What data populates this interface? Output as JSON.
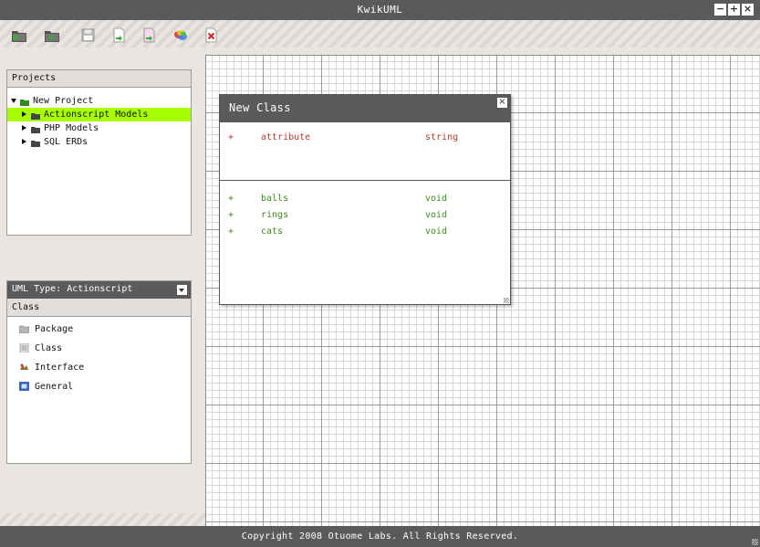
{
  "window": {
    "title": "KwikUML",
    "controls": {
      "minimize": "−",
      "maximize": "+",
      "close": "×"
    }
  },
  "toolbar": {
    "buttons": [
      {
        "name": "new-project-button",
        "icon": "new-folder-icon"
      },
      {
        "name": "open-project-button",
        "icon": "open-folder-icon"
      },
      {
        "name": "save-button",
        "icon": "floppy-disk-icon"
      },
      {
        "name": "import-button",
        "icon": "import-document-icon"
      },
      {
        "name": "export-button",
        "icon": "export-document-icon"
      },
      {
        "name": "colors-button",
        "icon": "color-blobs-icon"
      },
      {
        "name": "delete-button",
        "icon": "red-x-icon"
      }
    ]
  },
  "projects": {
    "header": "Projects",
    "tree": [
      {
        "label": "New Project",
        "expanded": true,
        "selected": false,
        "depth": 0
      },
      {
        "label": "Actionscript Models",
        "expanded": false,
        "selected": true,
        "depth": 1
      },
      {
        "label": "PHP Models",
        "expanded": false,
        "selected": false,
        "depth": 1
      },
      {
        "label": "SQL ERDs",
        "expanded": false,
        "selected": false,
        "depth": 1
      }
    ]
  },
  "uml": {
    "header": "UML Type: Actionscript",
    "subheader": "Class",
    "tools": [
      {
        "label": "Package",
        "icon": "package-icon"
      },
      {
        "label": "Class",
        "icon": "class-icon"
      },
      {
        "label": "Interface",
        "icon": "interface-icon"
      },
      {
        "label": "General",
        "icon": "general-icon"
      }
    ]
  },
  "class_window": {
    "title": "New Class",
    "close": "×",
    "attributes": [
      {
        "visibility": "+",
        "name": "attribute",
        "type": "string"
      }
    ],
    "methods": [
      {
        "visibility": "+",
        "name": "balls",
        "type": "void"
      },
      {
        "visibility": "+",
        "name": "rings",
        "type": "void"
      },
      {
        "visibility": "+",
        "name": "cats",
        "type": "void"
      }
    ]
  },
  "footer": {
    "copyright": "Copyright 2008 Otuome Labs. All Rights Reserved."
  },
  "colors": {
    "title_bar": "#5a5a5a",
    "selection": "#a8ff00",
    "attribute_text": "#b43a2a",
    "method_text": "#3d8a1e",
    "folder": "#444444",
    "root_folder": "#2e8b1e"
  }
}
